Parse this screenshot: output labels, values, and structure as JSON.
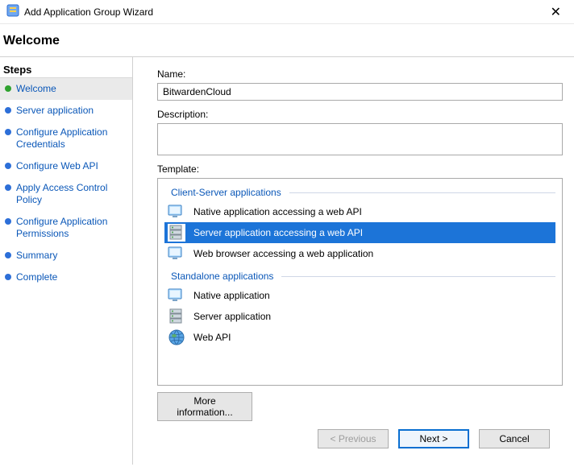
{
  "window": {
    "title": "Add Application Group Wizard"
  },
  "page": {
    "heading": "Welcome"
  },
  "sidebar": {
    "heading": "Steps",
    "items": [
      {
        "label": "Welcome",
        "state": "done",
        "current": true
      },
      {
        "label": "Server application",
        "state": "pending",
        "current": false
      },
      {
        "label": "Configure Application Credentials",
        "state": "pending",
        "current": false
      },
      {
        "label": "Configure Web API",
        "state": "pending",
        "current": false
      },
      {
        "label": "Apply Access Control Policy",
        "state": "pending",
        "current": false
      },
      {
        "label": "Configure Application Permissions",
        "state": "pending",
        "current": false
      },
      {
        "label": "Summary",
        "state": "pending",
        "current": false
      },
      {
        "label": "Complete",
        "state": "pending",
        "current": false
      }
    ]
  },
  "form": {
    "name_label": "Name:",
    "name_value": "BitwardenCloud",
    "description_label": "Description:",
    "description_value": "",
    "template_label": "Template:",
    "groups": [
      {
        "title": "Client-Server applications",
        "items": [
          {
            "label": "Native application accessing a web API",
            "icon": "monitor-api-icon",
            "selected": false
          },
          {
            "label": "Server application accessing a web API",
            "icon": "server-api-icon",
            "selected": true
          },
          {
            "label": "Web browser accessing a web application",
            "icon": "monitor-app-icon",
            "selected": false
          }
        ]
      },
      {
        "title": "Standalone applications",
        "items": [
          {
            "label": "Native application",
            "icon": "monitor-icon",
            "selected": false
          },
          {
            "label": "Server application",
            "icon": "server-icon",
            "selected": false
          },
          {
            "label": "Web API",
            "icon": "globe-icon",
            "selected": false
          }
        ]
      }
    ],
    "more_info": "More information..."
  },
  "buttons": {
    "previous": "< Previous",
    "next": "Next >",
    "cancel": "Cancel"
  }
}
